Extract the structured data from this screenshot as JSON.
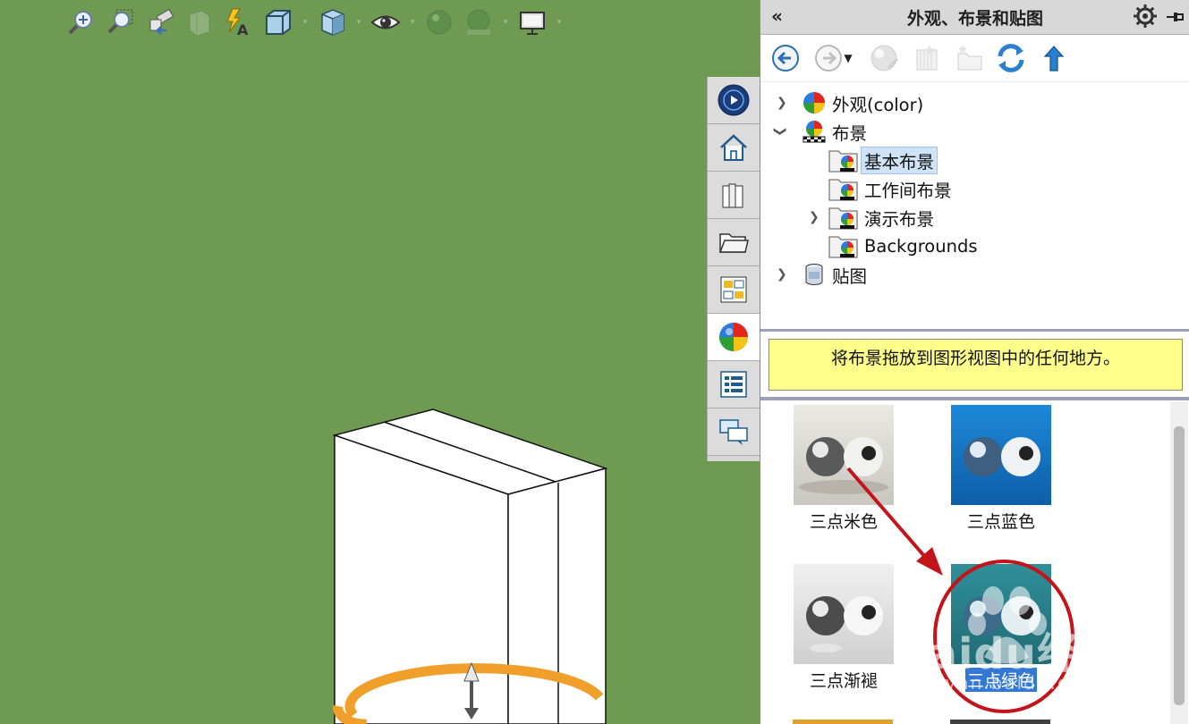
{
  "panel": {
    "title": "外观、布景和贴图",
    "collapse_glyph": "«",
    "toolbar": [
      "back-arrow-icon",
      "forward-arrow-icon",
      "sphere-icon",
      "book-icon",
      "new-folder-icon",
      "refresh-icon",
      "up-arrow-icon"
    ]
  },
  "tree": {
    "items": [
      {
        "label": "外观(color)",
        "expanded": false
      },
      {
        "label": "布景",
        "expanded": true
      },
      {
        "label": "基本布景",
        "selected": true
      },
      {
        "label": "工作间布景"
      },
      {
        "label": "演示布景",
        "expanded": false
      },
      {
        "label": "Backgrounds"
      },
      {
        "label": "贴图",
        "expanded": false
      }
    ]
  },
  "hint": "将布景拖放到图形视图中的任何地方。",
  "thumbnails": [
    {
      "label": "三点米色",
      "bg": "#d8d6d0"
    },
    {
      "label": "三点蓝色",
      "bg": "#1577c9"
    },
    {
      "label": "三点渐褪",
      "bg": "#e2e2e2"
    },
    {
      "label": "三点绿色",
      "bg": "#2b8690",
      "selected": true
    }
  ],
  "watermark": "Baidu经验",
  "watermark_url": "jingyan.baidu.com",
  "colors": {
    "viewport": "#6f9a51",
    "accent_red": "#c4141b",
    "hint_bg": "#ffff8c",
    "handle": "#f0a02a"
  }
}
